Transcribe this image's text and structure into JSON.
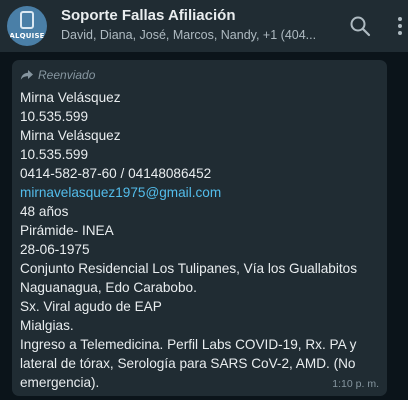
{
  "header": {
    "avatar_text": "ALQUISE",
    "title": "Soporte Fallas Afiliación",
    "participants": "David, Diana, José, Marcos, Nandy, +1 (404..."
  },
  "icons": {
    "search": "search-icon",
    "menu": "more-vertical-icon",
    "forward": "forward-arrow-icon"
  },
  "message": {
    "forwarded_label": "Reenviado",
    "lines": [
      "Mirna Velásquez",
      "10.535.599",
      "Mirna Velásquez",
      "10.535.599",
      "0414-582-87-60 / 04148086452",
      "mirnavelasquez1975@gmail.com",
      "48 años",
      "Pirámide- INEA",
      "28-06-1975",
      "Conjunto Residencial Los Tulipanes, Vía los Guallabitos",
      "Naguanagua, Edo Carabobo.",
      "Sx. Viral agudo de EAP",
      "Mialgias.",
      "Ingreso a Telemedicina. Perfil Labs COVID-19, Rx. PA y",
      "lateral de tórax, Serología para SARS CoV-2, AMD. (No",
      "emergencia)."
    ],
    "time": "1:10 p. m."
  },
  "colors": {
    "background": "#0b141a",
    "header": "#202c33",
    "bubble": "#202c33",
    "link": "#53bdeb",
    "muted": "#8696a0"
  }
}
